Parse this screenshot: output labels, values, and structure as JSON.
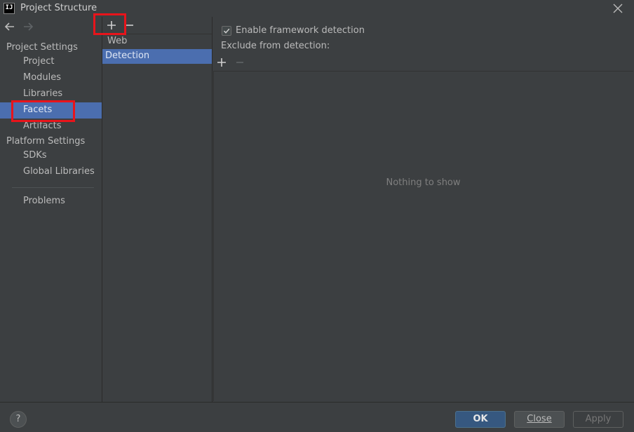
{
  "window": {
    "title": "Project Structure",
    "app_icon_label": "IJ"
  },
  "navigation": {
    "back_icon": "arrow-left-icon",
    "forward_icon": "arrow-right-icon",
    "sections": [
      {
        "header": "Project Settings",
        "items": [
          "Project",
          "Modules",
          "Libraries",
          "Facets",
          "Artifacts"
        ]
      },
      {
        "header": "Platform Settings",
        "items": [
          "SDKs",
          "Global Libraries"
        ]
      }
    ],
    "extra_items": [
      "Problems"
    ],
    "selected": "Facets"
  },
  "facets_list": {
    "add_icon": "plus-icon",
    "remove_icon": "minus-icon",
    "items": [
      "Web",
      "Detection"
    ],
    "selected": "Detection"
  },
  "detection": {
    "enable_label": "Enable framework detection",
    "enable_checked": true,
    "exclude_label": "Exclude from detection:",
    "empty_text": "Nothing to show"
  },
  "footer": {
    "help_label": "?",
    "ok_label": "OK",
    "close_label": "Close",
    "apply_label": "Apply"
  },
  "colors": {
    "background": "#3c3f41",
    "selection": "#4b6eaf",
    "primary_button": "#365880",
    "highlight": "#e8141b"
  }
}
